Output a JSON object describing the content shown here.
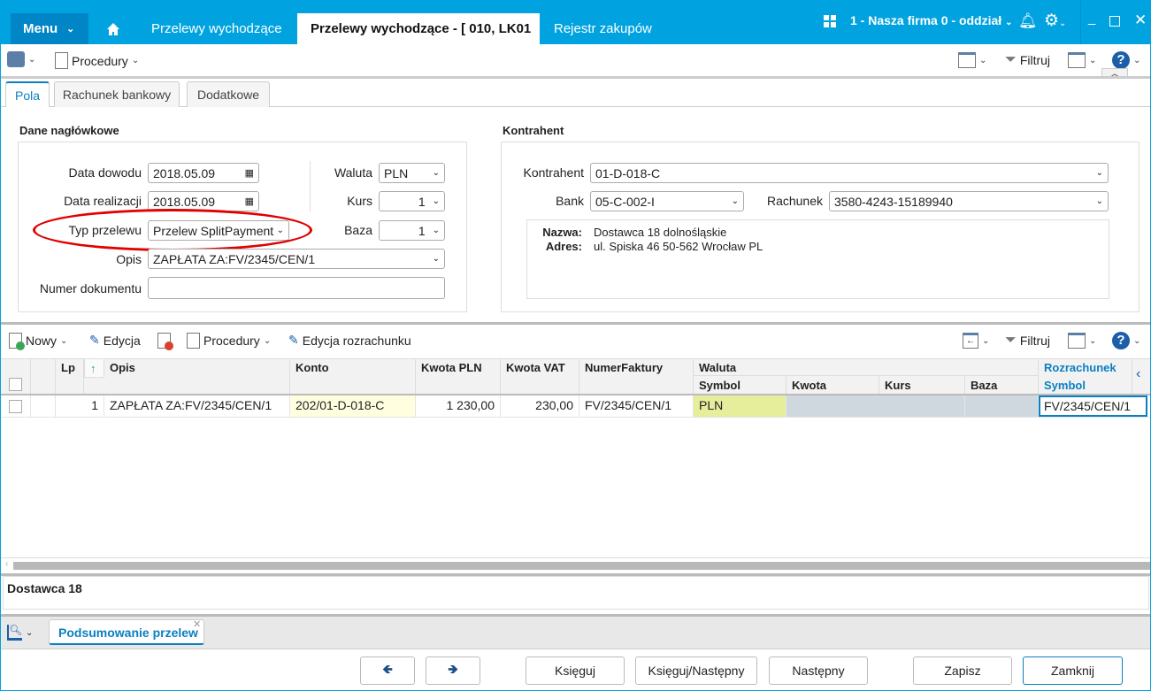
{
  "titlebar": {
    "menu": "Menu",
    "tabs": [
      "Przelewy wychodzące",
      "Przelewy wychodzące - [ 010, LK01",
      "Rejestr zakupów"
    ],
    "company": "1 - Nasza firma 0 - oddział"
  },
  "toolbar": {
    "procedury": "Procedury",
    "filtruj": "Filtruj"
  },
  "subtabs": [
    "Pola",
    "Rachunek bankowy",
    "Dodatkowe"
  ],
  "header_section": {
    "title": "Dane nagłówkowe",
    "data_dowodu_label": "Data dowodu",
    "data_dowodu": "2018.05.09",
    "data_realizacji_label": "Data realizacji",
    "data_realizacji": "2018.05.09",
    "typ_label": "Typ przelewu",
    "typ": "Przelew SplitPayment",
    "opis_label": "Opis",
    "opis": "ZAPŁATA ZA:FV/2345/CEN/1",
    "numer_label": "Numer dokumentu",
    "numer": "",
    "waluta_label": "Waluta",
    "waluta": "PLN",
    "kurs_label": "Kurs",
    "kurs": "1",
    "baza_label": "Baza",
    "baza": "1"
  },
  "kontrahent_section": {
    "title": "Kontrahent",
    "kontrahent_label": "Kontrahent",
    "kontrahent": "01-D-018-C",
    "bank_label": "Bank",
    "bank": "05-C-002-I",
    "rachunek_label": "Rachunek",
    "rachunek": "3580-4243-15189940",
    "nazwa_label": "Nazwa:",
    "nazwa": "Dostawca 18 dolnośląskie",
    "adres_label": "Adres:",
    "adres": "ul. Spiska 46 50-562 Wrocław PL"
  },
  "grid_toolbar": {
    "nowy": "Nowy",
    "edycja": "Edycja",
    "procedury": "Procedury",
    "edycja_rozrachunku": "Edycja rozrachunku",
    "filtruj": "Filtruj"
  },
  "grid": {
    "columns": {
      "lp": "Lp",
      "opis": "Opis",
      "konto": "Konto",
      "kwota_pln": "Kwota PLN",
      "kwota_vat": "Kwota VAT",
      "numer": "NumerFaktury",
      "waluta": "Waluta",
      "symbol": "Symbol",
      "kwota": "Kwota",
      "kurs": "Kurs",
      "baza": "Baza",
      "rozrachunek": "Rozrachunek",
      "rozr_symbol": "Symbol"
    },
    "rows": [
      {
        "lp": "1",
        "opis": "ZAPŁATA ZA:FV/2345/CEN/1",
        "konto": "202/01-D-018-C",
        "kwota_pln": "1 230,00",
        "kwota_vat": "230,00",
        "numer": "FV/2345/CEN/1",
        "symbol": "PLN",
        "kwota": "",
        "kurs": "",
        "baza": "",
        "rozr_symbol": "FV/2345/CEN/1"
      }
    ]
  },
  "detail_panel": {
    "text": "Dostawca 18"
  },
  "bottom_tab": {
    "label": "Podsumowanie przelew"
  },
  "buttons": {
    "ksieguj": "Księguj",
    "ksieguj_nastepny": "Księguj/Następny",
    "nastepny": "Następny",
    "zapisz": "Zapisz",
    "zamknij": "Zamknij"
  },
  "colors": {
    "brand": "#00a3e0",
    "menu": "#0085c7",
    "highlight": "#e00000"
  }
}
